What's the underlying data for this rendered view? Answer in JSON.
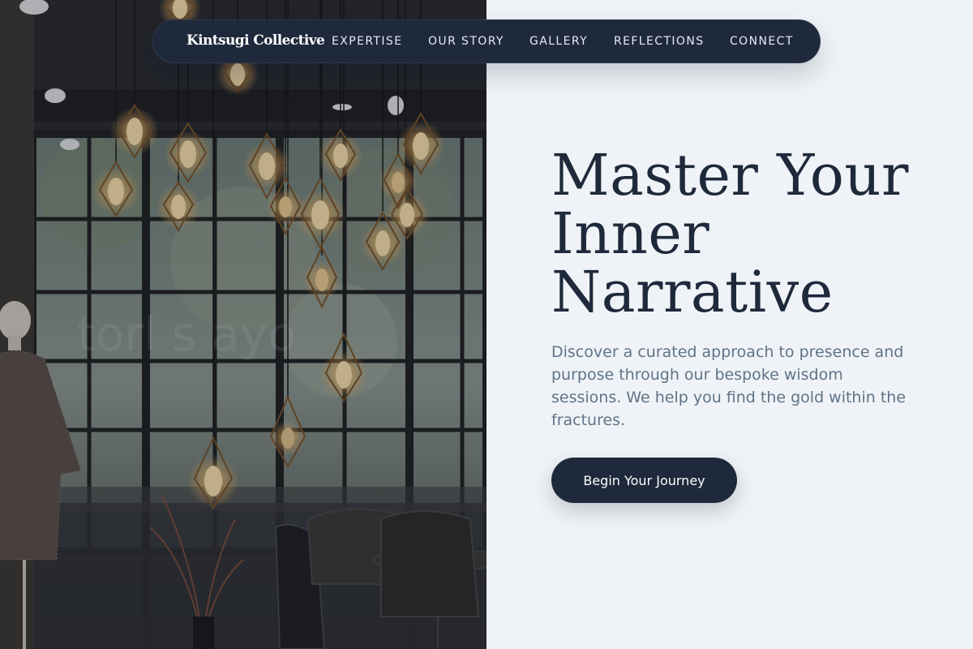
{
  "nav": {
    "brand": "Kintsugi Collective",
    "links": [
      "EXPERTISE",
      "OUR STORY",
      "GALLERY",
      "REFLECTIONS",
      "CONNECT"
    ]
  },
  "hero": {
    "headline_lines": [
      "Master Your",
      "Inner",
      "Narrative"
    ],
    "subtext": "Discover a curated approach to presence and purpose through our bespoke wisdom sessions. We help you find the gold within the fractures.",
    "cta_label": "Begin Your Journey"
  },
  "photo": {
    "subject": "dim cafe interior with hanging Edison-bulb cage pendant lamps, large dark-framed windows, a mannequin wearing a tweed coat, and cafe chairs"
  },
  "colors": {
    "navy": "#1e293b",
    "background": "#eff3f7",
    "subtext": "#5f7388",
    "bulb_glow": "#f4c77a"
  }
}
